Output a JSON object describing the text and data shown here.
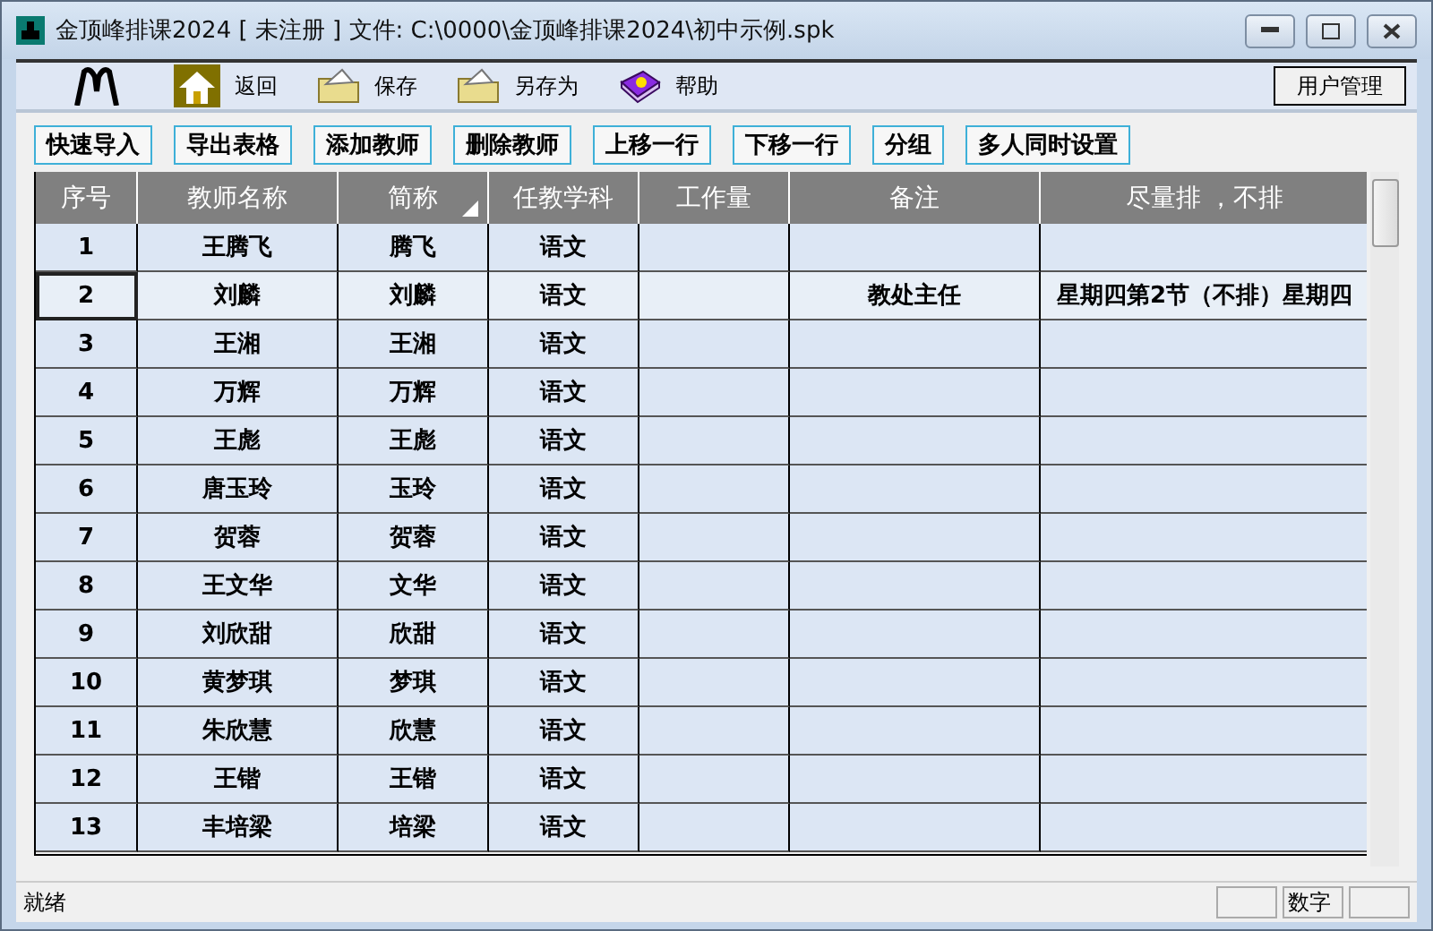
{
  "window": {
    "title": "金顶峰排课2024 [ 未注册 ] 文件: C:\\0000\\金顶峰排课2024\\初中示例.spk"
  },
  "toolbar": {
    "items": [
      {
        "kind": "home",
        "label": "返回"
      },
      {
        "kind": "save",
        "label": "保存"
      },
      {
        "kind": "saveas",
        "label": "另存为"
      },
      {
        "kind": "help",
        "label": "帮助"
      }
    ],
    "user_button": "用户管理"
  },
  "actions": [
    "快速导入",
    "导出表格",
    "添加教师",
    "删除教师",
    "上移一行",
    "下移一行",
    "分组",
    "多人同时设置"
  ],
  "table": {
    "columns": [
      {
        "label": "序号",
        "sorted": false
      },
      {
        "label": "教师名称",
        "sorted": false
      },
      {
        "label": "简称",
        "sorted": true
      },
      {
        "label": "任教学科",
        "sorted": false
      },
      {
        "label": "工作量",
        "sorted": false
      },
      {
        "label": "备注",
        "sorted": false
      },
      {
        "label": "尽量排 ，不排",
        "sorted": false
      }
    ],
    "rows": [
      {
        "selected": false,
        "cells": [
          "1",
          "王腾飞",
          "腾飞",
          "语文",
          "",
          "",
          ""
        ]
      },
      {
        "selected": true,
        "cells": [
          "2",
          "刘麟",
          "刘麟",
          "语文",
          "",
          "教处主任",
          "星期四第2节（不排）星期四"
        ]
      },
      {
        "selected": false,
        "cells": [
          "3",
          "王湘",
          "王湘",
          "语文",
          "",
          "",
          ""
        ]
      },
      {
        "selected": false,
        "cells": [
          "4",
          "万辉",
          "万辉",
          "语文",
          "",
          "",
          ""
        ]
      },
      {
        "selected": false,
        "cells": [
          "5",
          "王彪",
          "王彪",
          "语文",
          "",
          "",
          ""
        ]
      },
      {
        "selected": false,
        "cells": [
          "6",
          "唐玉玲",
          "玉玲",
          "语文",
          "",
          "",
          ""
        ]
      },
      {
        "selected": false,
        "cells": [
          "7",
          "贺蓉",
          "贺蓉",
          "语文",
          "",
          "",
          ""
        ]
      },
      {
        "selected": false,
        "cells": [
          "8",
          "王文华",
          "文华",
          "语文",
          "",
          "",
          ""
        ]
      },
      {
        "selected": false,
        "cells": [
          "9",
          "刘欣甜",
          "欣甜",
          "语文",
          "",
          "",
          ""
        ]
      },
      {
        "selected": false,
        "cells": [
          "10",
          "黄梦琪",
          "梦琪",
          "语文",
          "",
          "",
          ""
        ]
      },
      {
        "selected": false,
        "cells": [
          "11",
          "朱欣慧",
          "欣慧",
          "语文",
          "",
          "",
          ""
        ]
      },
      {
        "selected": false,
        "cells": [
          "12",
          "王锴",
          "王锴",
          "语文",
          "",
          "",
          ""
        ]
      },
      {
        "selected": false,
        "cells": [
          "13",
          "丰培梁",
          "培梁",
          "语文",
          "",
          "",
          ""
        ]
      }
    ]
  },
  "status_bar": {
    "message": "就绪",
    "num_indicator": "数字"
  }
}
